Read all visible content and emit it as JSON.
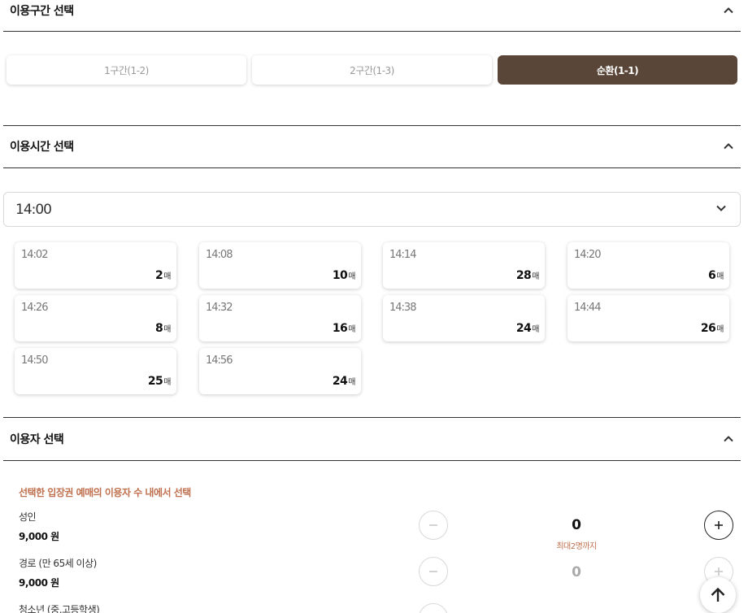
{
  "sections": {
    "route": {
      "title": "이용구간 선택"
    },
    "time": {
      "title": "이용시간 선택"
    },
    "users": {
      "title": "이용자 선택"
    }
  },
  "routes": [
    {
      "label": "1구간(1-2)",
      "selected": false
    },
    {
      "label": "2구간(1-3)",
      "selected": false
    },
    {
      "label": "순환(1-1)",
      "selected": true
    }
  ],
  "time_select": {
    "value": "14:00"
  },
  "slots": [
    {
      "time": "14:02",
      "count": "2",
      "unit": "매"
    },
    {
      "time": "14:08",
      "count": "10",
      "unit": "매"
    },
    {
      "time": "14:14",
      "count": "28",
      "unit": "매"
    },
    {
      "time": "14:20",
      "count": "6",
      "unit": "매"
    },
    {
      "time": "14:26",
      "count": "8",
      "unit": "매"
    },
    {
      "time": "14:32",
      "count": "16",
      "unit": "매"
    },
    {
      "time": "14:38",
      "count": "24",
      "unit": "매"
    },
    {
      "time": "14:44",
      "count": "26",
      "unit": "매"
    },
    {
      "time": "14:50",
      "count": "25",
      "unit": "매"
    },
    {
      "time": "14:56",
      "count": "24",
      "unit": "매"
    }
  ],
  "users_notice": "선택한 입장권 예매의 이용자 수 내에서 선택",
  "users": [
    {
      "name": "성인",
      "price": "9,000 원",
      "qty": "0",
      "note": "최대2명까지"
    },
    {
      "name": "경로 (만 65세 이상)",
      "price": "9,000 원",
      "qty": "0"
    },
    {
      "name": "청소년 (중,고등학생)"
    }
  ],
  "colors": {
    "accent": "#5a4638",
    "notice": "#c0704e"
  },
  "icons": {
    "section_toggle": "chevron-up-icon",
    "select": "chevron-down-icon",
    "decrease": "minus-icon",
    "increase": "plus-icon",
    "scroll_top": "arrow-up-icon"
  }
}
